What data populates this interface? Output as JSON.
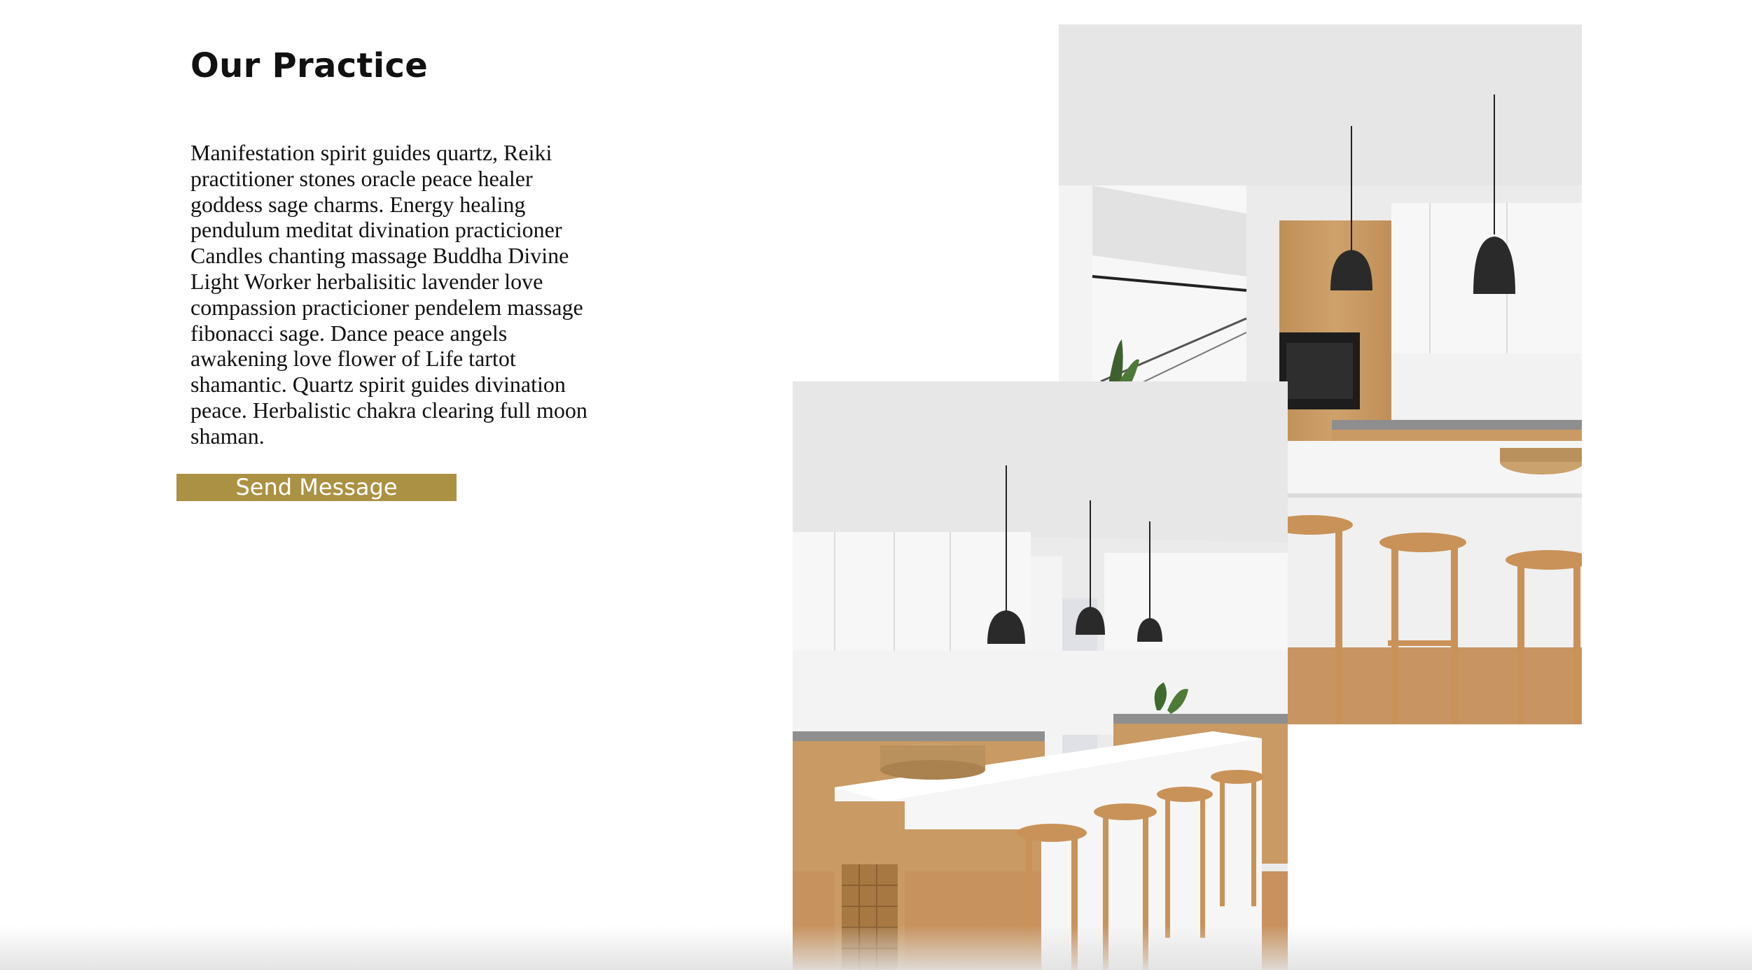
{
  "section": {
    "heading": "Our Practice",
    "body": "Manifestation spirit guides quartz, Reiki practitioner stones oracle peace healer goddess sage charms. Energy healing pendulum meditat divination practicioner Candles chanting massage Buddha Divine Light Worker herbalisitic lavender love compassion practicioner pendelem massage fibonacci sage. Dance peace angels awakening love flower of Life tartot shamantic. Quartz spirit guides divination peace. Herbalistic chakra clearing full moon shaman.",
    "button_label": "Send Message"
  },
  "photos": [
    {
      "subject": "kitchen-interior-photo",
      "alt": ""
    },
    {
      "subject": "kitchen-island-photo",
      "alt": ""
    }
  ],
  "colors": {
    "accent": "#ab9143",
    "text": "#111111",
    "background": "#ffffff"
  }
}
